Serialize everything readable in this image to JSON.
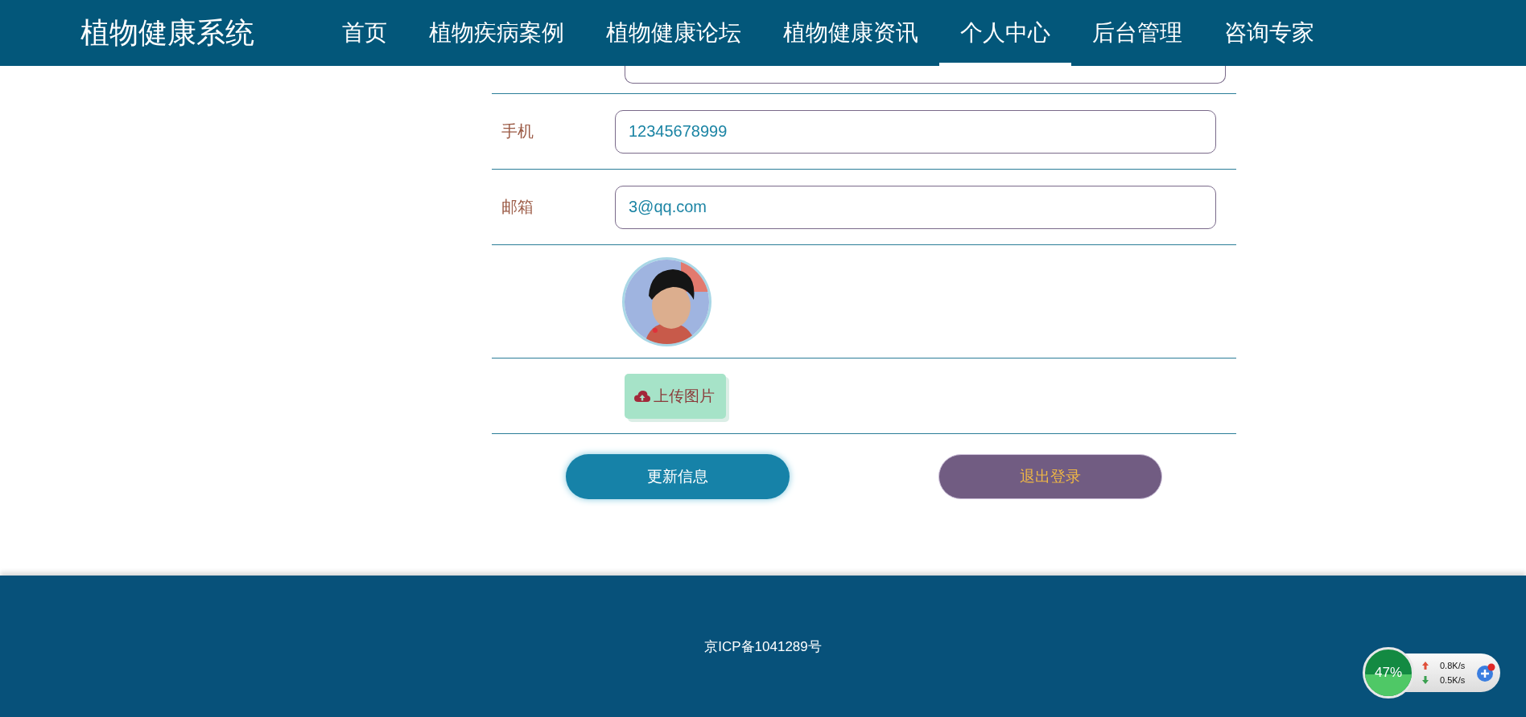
{
  "header": {
    "title": "植物健康系统",
    "nav": [
      {
        "label": "首页",
        "selected": false
      },
      {
        "label": "植物疾病案例",
        "selected": false
      },
      {
        "label": "植物健康论坛",
        "selected": false
      },
      {
        "label": "植物健康资讯",
        "selected": false
      },
      {
        "label": "个人中心",
        "selected": true
      },
      {
        "label": "后台管理",
        "selected": false
      },
      {
        "label": "咨询专家",
        "selected": false
      }
    ]
  },
  "form": {
    "rows": [
      {
        "kind": "cut_field"
      },
      {
        "kind": "field",
        "label": "手机",
        "value": "12345678999"
      },
      {
        "kind": "field",
        "label": "邮箱",
        "value": "3@qq.com"
      },
      {
        "kind": "avatar"
      },
      {
        "kind": "upload",
        "label": "上传图片"
      }
    ]
  },
  "actions": [
    {
      "kind": "primary",
      "label": "更新信息"
    },
    {
      "kind": "secondary",
      "label": "退出登录"
    }
  ],
  "footer": {
    "icp": "京ICP备1041289号"
  },
  "speed_widget": {
    "percent": "47%",
    "upload": "0.8K/s",
    "download": "0.5K/s"
  }
}
